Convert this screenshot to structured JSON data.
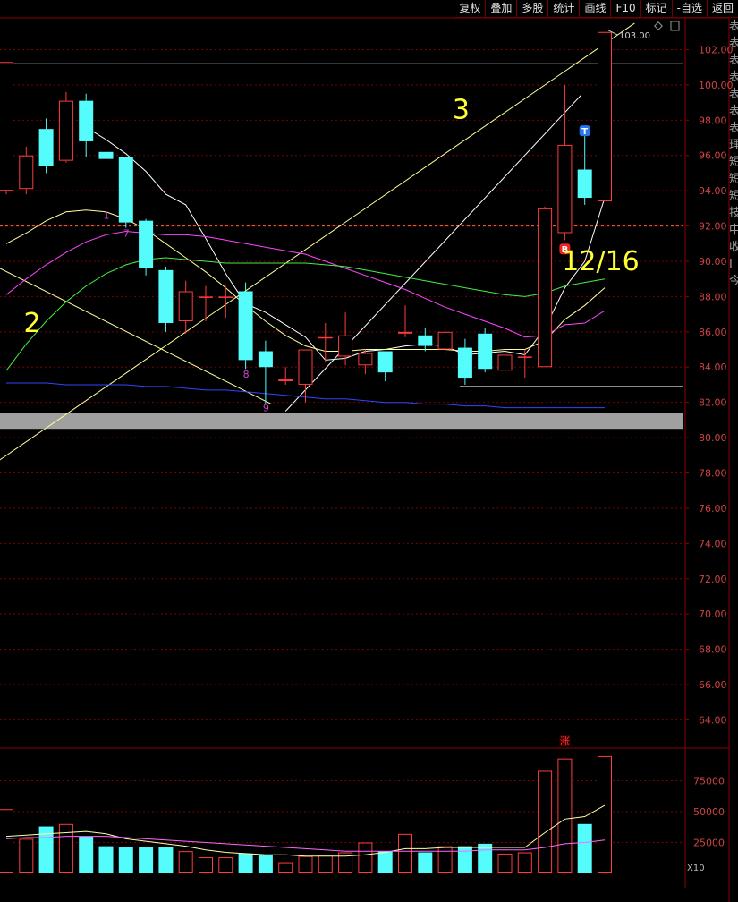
{
  "toolbar": {
    "buttons": [
      "复权",
      "叠加",
      "多股",
      "统计",
      "画线",
      "F10",
      "标记",
      "-自选",
      "返回"
    ]
  },
  "right_strip": {
    "chars": [
      "表",
      "表",
      "表",
      "表",
      "表",
      "表",
      "表",
      "理",
      "短",
      "短",
      "短",
      "技",
      "中",
      "收",
      "Ⅰ",
      "今"
    ]
  },
  "colors": {
    "background": "#000000",
    "up": "#ff3b3b",
    "down": "#54fcfc",
    "ma5": "#ffffff",
    "ma10": "#ffff99",
    "ma20": "#ff44ff",
    "ma60": "#44ee44",
    "ma250": "#3344ff",
    "annotation": "#ffff33",
    "gridline": "#7a0000",
    "axis_label": "#cc4444"
  },
  "chart_data": {
    "type": "candlestick",
    "price_axis": {
      "ylim": [
        62.5,
        103.8
      ],
      "ticks": [
        64,
        66,
        68,
        70,
        72,
        74,
        76,
        78,
        80,
        82,
        84,
        86,
        88,
        90,
        92,
        94,
        96,
        98,
        100,
        102
      ],
      "tick_labels": [
        "64.00",
        "66.00",
        "68.00",
        "70.00",
        "72.00",
        "74.00",
        "76.00",
        "78.00",
        "80.00",
        "82.00",
        "84.00",
        "86.00",
        "88.00",
        "90.00",
        "92.00",
        "94.00",
        "96.00",
        "98.00",
        "100.00",
        "102.00"
      ]
    },
    "candles": [
      {
        "o": 94.0,
        "h": 101.3,
        "l": 93.8,
        "c": 101.3
      },
      {
        "o": 94.1,
        "h": 96.5,
        "l": 93.8,
        "c": 96.0
      },
      {
        "o": 97.5,
        "h": 98.1,
        "l": 95.0,
        "c": 95.4
      },
      {
        "o": 95.7,
        "h": 99.6,
        "l": 95.6,
        "c": 99.1
      },
      {
        "o": 99.1,
        "h": 99.5,
        "l": 95.9,
        "c": 96.8
      },
      {
        "o": 96.2,
        "h": 96.3,
        "l": 93.3,
        "c": 95.8
      },
      {
        "o": 95.9,
        "h": 95.9,
        "l": 91.9,
        "c": 92.2
      },
      {
        "o": 92.3,
        "h": 92.4,
        "l": 89.2,
        "c": 89.6
      },
      {
        "o": 89.5,
        "h": 89.7,
        "l": 86.0,
        "c": 86.5
      },
      {
        "o": 86.6,
        "h": 88.9,
        "l": 85.9,
        "c": 88.3
      },
      {
        "o": 88.0,
        "h": 88.6,
        "l": 86.6,
        "c": 88.0
      },
      {
        "o": 88.0,
        "h": 88.6,
        "l": 86.8,
        "c": 88.0
      },
      {
        "o": 88.3,
        "h": 88.8,
        "l": 83.9,
        "c": 84.4
      },
      {
        "o": 84.9,
        "h": 85.5,
        "l": 81.9,
        "c": 84.0
      },
      {
        "o": 83.2,
        "h": 84.0,
        "l": 83.0,
        "c": 83.3
      },
      {
        "o": 83.0,
        "h": 85.0,
        "l": 82.0,
        "c": 85.0
      },
      {
        "o": 85.7,
        "h": 86.5,
        "l": 84.3,
        "c": 85.7
      },
      {
        "o": 84.6,
        "h": 87.1,
        "l": 84.1,
        "c": 85.8
      },
      {
        "o": 84.1,
        "h": 85.0,
        "l": 83.6,
        "c": 84.8
      },
      {
        "o": 84.9,
        "h": 84.9,
        "l": 83.2,
        "c": 83.7
      },
      {
        "o": 85.9,
        "h": 87.5,
        "l": 85.7,
        "c": 86.0
      },
      {
        "o": 85.8,
        "h": 86.2,
        "l": 84.9,
        "c": 85.2
      },
      {
        "o": 85.0,
        "h": 86.2,
        "l": 84.7,
        "c": 86.0
      },
      {
        "o": 85.1,
        "h": 85.6,
        "l": 83.0,
        "c": 83.4
      },
      {
        "o": 85.9,
        "h": 86.2,
        "l": 83.7,
        "c": 83.9
      },
      {
        "o": 83.8,
        "h": 85.0,
        "l": 83.3,
        "c": 84.7
      },
      {
        "o": 84.6,
        "h": 85.0,
        "l": 83.4,
        "c": 84.6
      },
      {
        "o": 84.0,
        "h": 93.1,
        "l": 84.0,
        "c": 93.0
      },
      {
        "o": 91.6,
        "h": 100.0,
        "l": 91.2,
        "c": 96.6
      },
      {
        "o": 95.2,
        "h": 97.1,
        "l": 93.2,
        "c": 93.6
      },
      {
        "o": 93.4,
        "h": 103.0,
        "l": 93.4,
        "c": 103.0
      }
    ],
    "ma_lines": [
      {
        "name": "MA5",
        "color": "#ffffff",
        "values": [
          null,
          null,
          null,
          null,
          97.6,
          96.9,
          96.1,
          95.1,
          93.8,
          93.2,
          91.3,
          89.3,
          87.6,
          87.1,
          86.4,
          85.7,
          84.4,
          84.5,
          84.9,
          85.0,
          85.2,
          85.3,
          85.2,
          84.7,
          84.8,
          84.9,
          84.7,
          86.2,
          88.5,
          90.0,
          93.6
        ]
      },
      {
        "name": "MA10",
        "color": "#ffff99",
        "values": [
          91.0,
          91.6,
          92.3,
          92.8,
          92.9,
          92.8,
          92.4,
          91.8,
          91.0,
          90.2,
          89.4,
          88.5,
          87.5,
          86.6,
          85.8,
          85.2,
          84.9,
          84.9,
          85.0,
          85.0,
          85.0,
          85.0,
          85.0,
          84.9,
          84.9,
          85.0,
          85.0,
          85.5,
          86.7,
          87.5,
          88.5
        ]
      },
      {
        "name": "MA20",
        "color": "#ff44ff",
        "values": [
          88.1,
          89.0,
          89.8,
          90.5,
          91.1,
          91.5,
          91.7,
          91.6,
          91.5,
          91.5,
          91.4,
          91.2,
          91.0,
          90.8,
          90.6,
          90.4,
          90.0,
          89.6,
          89.2,
          88.8,
          88.4,
          87.9,
          87.4,
          87.0,
          86.6,
          86.2,
          85.7,
          85.8,
          86.4,
          86.5,
          87.2
        ]
      },
      {
        "name": "MA60",
        "color": "#44ee44",
        "values": [
          83.8,
          85.3,
          86.6,
          87.7,
          88.6,
          89.3,
          89.8,
          90.1,
          90.2,
          90.1,
          90.0,
          89.9,
          89.9,
          89.9,
          89.9,
          89.9,
          89.8,
          89.7,
          89.5,
          89.3,
          89.1,
          88.9,
          88.7,
          88.5,
          88.3,
          88.1,
          88.0,
          88.2,
          88.6,
          88.8,
          89.0
        ]
      },
      {
        "name": "MA250",
        "color": "#3344ff",
        "values": [
          83.1,
          83.1,
          83.1,
          83.0,
          83.0,
          83.0,
          83.0,
          82.9,
          82.9,
          82.8,
          82.7,
          82.7,
          82.6,
          82.5,
          82.4,
          82.3,
          82.2,
          82.2,
          82.1,
          82.0,
          82.0,
          81.9,
          81.9,
          81.8,
          81.8,
          81.7,
          81.7,
          81.7,
          81.7,
          81.7,
          81.7
        ]
      }
    ],
    "annotations": [
      {
        "text": "2",
        "x_index": 1.3,
        "price": 86.0
      },
      {
        "text": "3",
        "x_index": 22.8,
        "price": 98.1
      },
      {
        "text": "12/16",
        "x_index": 29.8,
        "price": 89.5
      }
    ],
    "candle_labels": [
      {
        "text": "1",
        "index": 5,
        "price": 92.4,
        "color": "#cc44cc"
      },
      {
        "text": "7",
        "index": 6,
        "price": 91.4,
        "color": "#cc44cc"
      },
      {
        "text": "8",
        "index": 12,
        "price": 83.4,
        "color": "#cc44cc"
      },
      {
        "text": "9",
        "index": 13,
        "price": 81.5,
        "color": "#cc44cc"
      }
    ],
    "markers": [
      {
        "text": "B",
        "index": 28,
        "price": 90.7,
        "color": "#ee2222"
      },
      {
        "text": "T",
        "index": 29,
        "price": 97.4,
        "color": "#2277ee"
      }
    ],
    "max_label": {
      "text": "103.00",
      "index": 30,
      "price": 103.0
    },
    "horizontal_lines": [
      {
        "price": 101.2,
        "color": "#dddddd"
      },
      {
        "price": 92.0,
        "color": "#ff6633",
        "dashed": true
      },
      {
        "price": 82.9,
        "color": "#dddddd",
        "from_index": 23
      }
    ],
    "trend_lines": [
      {
        "color": "#ffff99",
        "from": [
          -0.5,
          89.7
        ],
        "to": [
          13.3,
          81.9
        ]
      },
      {
        "color": "#ffff99",
        "from": [
          -0.5,
          78.6
        ],
        "to": [
          31.5,
          103.5
        ]
      },
      {
        "color": "#ffffff",
        "from": [
          14,
          81.5
        ],
        "to": [
          28.8,
          99.4
        ]
      }
    ],
    "shaded_band": {
      "from": 80.5,
      "to": 81.4,
      "color": "#a0a0a0"
    },
    "volume": {
      "ticks": [
        25000,
        50000,
        75000
      ],
      "tick_labels": [
        "25000",
        "50000",
        "75000"
      ],
      "ylim": [
        0,
        100000
      ],
      "unit_label": "X10",
      "values": [
        52000,
        28000,
        38000,
        40000,
        30000,
        22000,
        21000,
        21000,
        21000,
        18000,
        13000,
        13000,
        16000,
        15000,
        9000,
        14000,
        15000,
        17000,
        25000,
        18000,
        32000,
        17000,
        22000,
        22000,
        24000,
        16000,
        17000,
        83000,
        93000,
        40000,
        95000
      ],
      "ma_lines": [
        {
          "name": "VMA5",
          "color": "#ffffaa",
          "values": [
            30000,
            31000,
            32000,
            33000,
            34000,
            32000,
            28000,
            26000,
            24000,
            22000,
            19000,
            17000,
            16000,
            15000,
            15000,
            14000,
            14000,
            14000,
            15000,
            17000,
            20000,
            20000,
            21000,
            21000,
            21000,
            21000,
            21000,
            33000,
            44000,
            46000,
            55000
          ]
        },
        {
          "name": "VMA10",
          "color": "#ff66ff",
          "values": [
            28000,
            29000,
            29000,
            30000,
            30000,
            30000,
            29000,
            28000,
            27000,
            26000,
            25000,
            24000,
            23000,
            22000,
            21000,
            20000,
            19000,
            18000,
            18000,
            18000,
            18000,
            18000,
            18000,
            18000,
            19000,
            19000,
            19000,
            21000,
            24000,
            25000,
            27000
          ]
        }
      ],
      "limit_up_mark": {
        "text": "涨",
        "index": 28
      }
    }
  }
}
